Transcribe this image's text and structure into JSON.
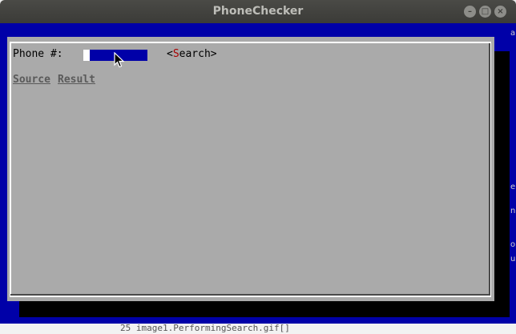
{
  "window": {
    "title": "PhoneChecker",
    "controls": [
      "minimize-icon",
      "maximize-icon",
      "close-icon"
    ]
  },
  "form": {
    "phone_label": "Phone #:",
    "phone_value": "",
    "search_prefix": "<",
    "search_hotkey": "S",
    "search_rest": "earch>"
  },
  "tabs": [
    {
      "label": "Source"
    },
    {
      "label": "Result"
    }
  ],
  "background": {
    "bottom_text": "25  image1.PerformingSearch.gif[]",
    "edge_glyphs": [
      "a",
      "e",
      "n",
      "o",
      "u"
    ]
  },
  "colors": {
    "terminal_bg": "#0000a8",
    "dialog_bg": "#aaaaaa",
    "hotkey": "#a80000",
    "title_text": "#bdbdb8"
  }
}
